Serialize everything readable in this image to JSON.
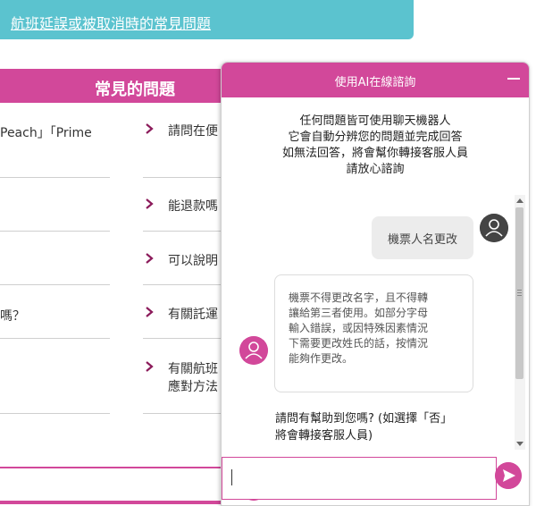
{
  "banner": {
    "link_text": "航班延誤或被取消時的常見問題"
  },
  "faq": {
    "title": "常見的問題",
    "left_items": [
      "Peach」「Prime",
      "嗎？"
    ],
    "items": [
      {
        "lines": [
          "請問在便"
        ]
      },
      {
        "lines": [
          "能退款嗎"
        ]
      },
      {
        "lines": [
          "可以說明"
        ]
      },
      {
        "lines": [
          "有關託運"
        ]
      },
      {
        "lines": [
          "有關航班",
          "應對方法"
        ]
      }
    ]
  },
  "chat": {
    "title": "使用AI在線諮詢",
    "intro": [
      "任何問題皆可使用聊天機器人",
      "它會自動分辨您的問題並完成回答",
      "如無法回答，將會幫你轉接客服人員",
      "請放心諮詢"
    ],
    "user_message": "機票人名更改",
    "bot_reply": [
      "機票不得更改名字，且不得轉",
      "讓給第三者使用。如部分字母",
      "輸入錯誤，或因特殊因素情況",
      "下需要更改姓氏的話，按情況",
      "能夠作更改。"
    ],
    "bot_question": [
      "請問有幫助到您嗎? (如選擇「否」",
      "將會轉接客服人員)"
    ],
    "input_value": ""
  },
  "colors": {
    "brand": "#d2489a",
    "banner": "#5bc3cf"
  }
}
